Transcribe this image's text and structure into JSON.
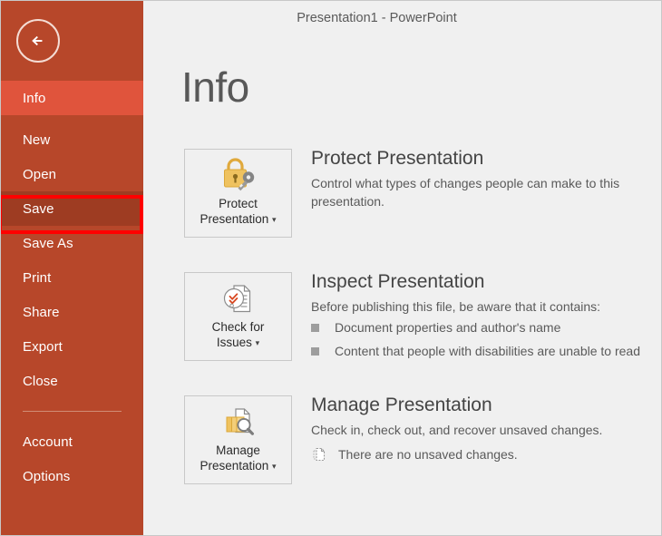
{
  "window": {
    "title": "Presentation1 - PowerPoint"
  },
  "colors": {
    "sidebar": "#B7472A",
    "sidebar_selected": "#E0543C",
    "sidebar_pressed": "#9E3C22",
    "highlight": "#FF0000",
    "content_bg": "#F0F0F0",
    "gold": "#E8BD5E",
    "red_check": "#D8471F"
  },
  "sidebar": {
    "back_icon": "back-arrow-icon",
    "items": [
      {
        "label": "Info",
        "state": "selected"
      },
      {
        "label": "New",
        "state": "normal"
      },
      {
        "label": "Open",
        "state": "normal"
      },
      {
        "label": "Save",
        "state": "pressed"
      },
      {
        "label": "Save As",
        "state": "normal"
      },
      {
        "label": "Print",
        "state": "normal"
      },
      {
        "label": "Share",
        "state": "normal"
      },
      {
        "label": "Export",
        "state": "normal"
      },
      {
        "label": "Close",
        "state": "normal"
      }
    ],
    "footer_items": [
      {
        "label": "Account"
      },
      {
        "label": "Options"
      }
    ]
  },
  "main": {
    "page_title": "Info",
    "sections": [
      {
        "button_label_line1": "Protect",
        "button_label_line2": "Presentation",
        "button_icon": "lock-key-icon",
        "has_caret": true,
        "heading": "Protect Presentation",
        "description": "Control what types of changes people can make to this presentation.",
        "bullets": [],
        "status": null
      },
      {
        "button_label_line1": "Check for",
        "button_label_line2": "Issues",
        "button_icon": "document-check-icon",
        "has_caret": true,
        "heading": "Inspect Presentation",
        "description": "Before publishing this file, be aware that it contains:",
        "bullets": [
          "Document properties and author's name",
          "Content that people with disabilities are unable to read"
        ],
        "status": null
      },
      {
        "button_label_line1": "Manage",
        "button_label_line2": "Presentation",
        "button_icon": "document-stack-search-icon",
        "has_caret": true,
        "heading": "Manage Presentation",
        "description": "Check in, check out, and recover unsaved changes.",
        "bullets": [],
        "status": {
          "icon": "unsaved-document-icon",
          "text": "There are no unsaved changes."
        }
      }
    ]
  }
}
